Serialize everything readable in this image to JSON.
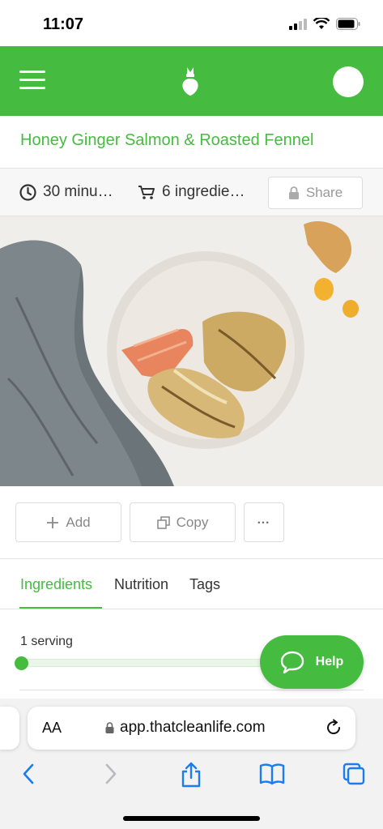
{
  "status": {
    "time": "11:07"
  },
  "header": {
    "menu_icon": "hamburger-icon",
    "logo_icon": "radish-logo-icon",
    "avatar_icon": "avatar"
  },
  "recipe": {
    "title": "Honey Ginger Salmon & Roasted Fennel",
    "time": "30 minu…",
    "ingredients": "6 ingredie…",
    "share_label": "Share"
  },
  "actions": {
    "add_label": "Add",
    "copy_label": "Copy",
    "more_label": "•••"
  },
  "tabs": [
    {
      "label": "Ingredients",
      "active": true
    },
    {
      "label": "Nutrition",
      "active": false
    },
    {
      "label": "Tags",
      "active": false
    }
  ],
  "serving": {
    "label": "1 serving",
    "slider_value": 0
  },
  "help": {
    "label": "Help"
  },
  "browser": {
    "aa": "AA",
    "url": "app.thatcleanlife.com"
  },
  "colors": {
    "brand": "#45bb3f",
    "safari_blue": "#1a7cf3"
  }
}
